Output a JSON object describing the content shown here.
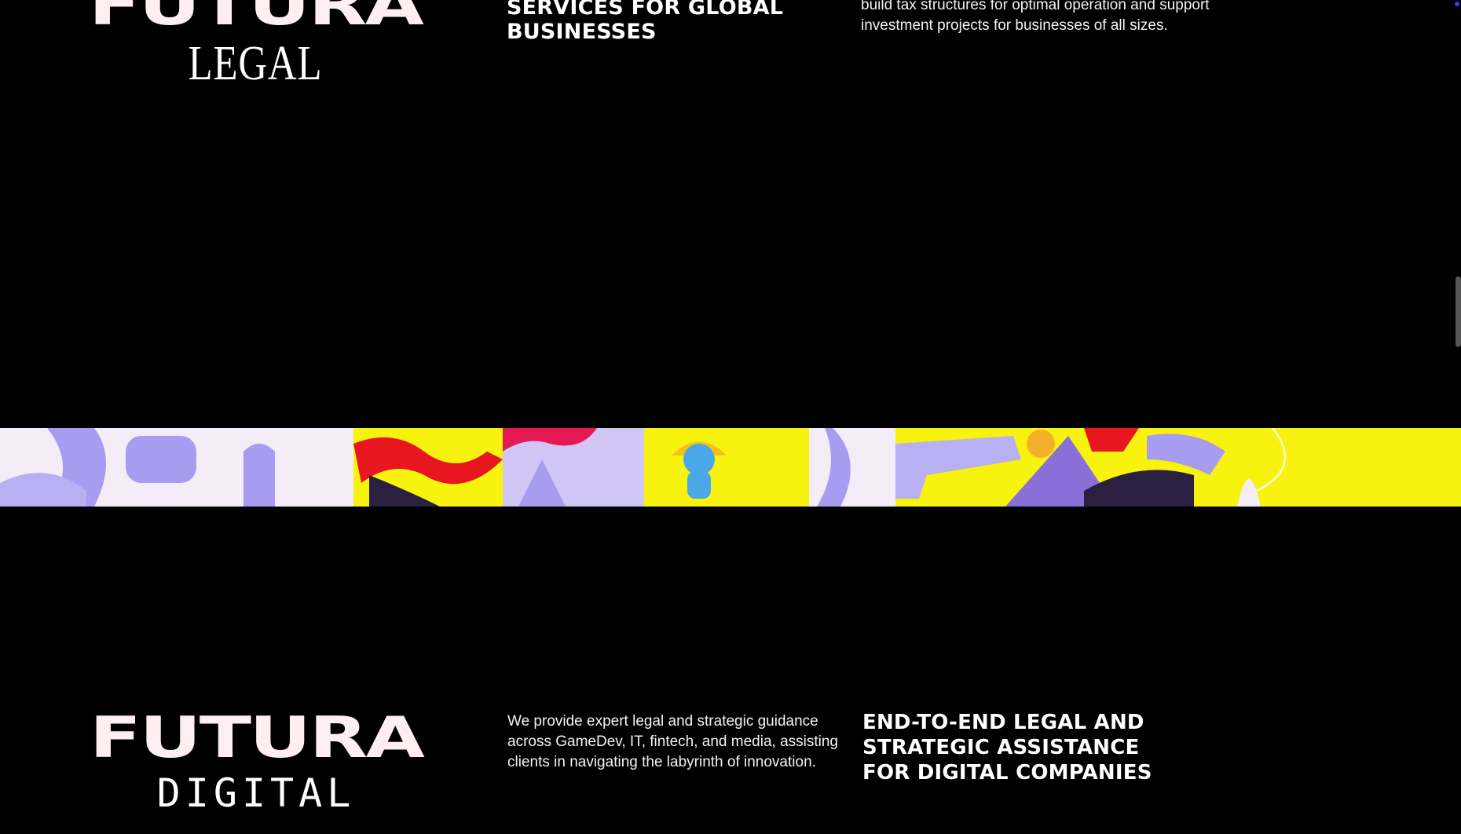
{
  "legal_section": {
    "logo_main": "FUTURA",
    "logo_sub": "LEGAL",
    "heading": "SERVICES FOR GLOBAL BUSINESSES",
    "description": "build tax structures for optimal operation and support investment projects for businesses of all sizes."
  },
  "digital_section": {
    "logo_main": "FUTURA",
    "logo_sub": "DIGITAL",
    "description": "We provide expert legal and strategic guidance across GameDev, IT, fintech, and media, assisting clients in navigating the labyrinth of innovation.",
    "heading": "END-TO-END LEGAL AND STRATEGIC ASSISTANCE FOR DIGITAL COMPANIES"
  },
  "colors": {
    "background": "#000000",
    "banner_yellow": "#f7f20e",
    "banner_lavender": "#a79cf0",
    "banner_red": "#e8161e",
    "logo_pink": "#fdeef2"
  }
}
